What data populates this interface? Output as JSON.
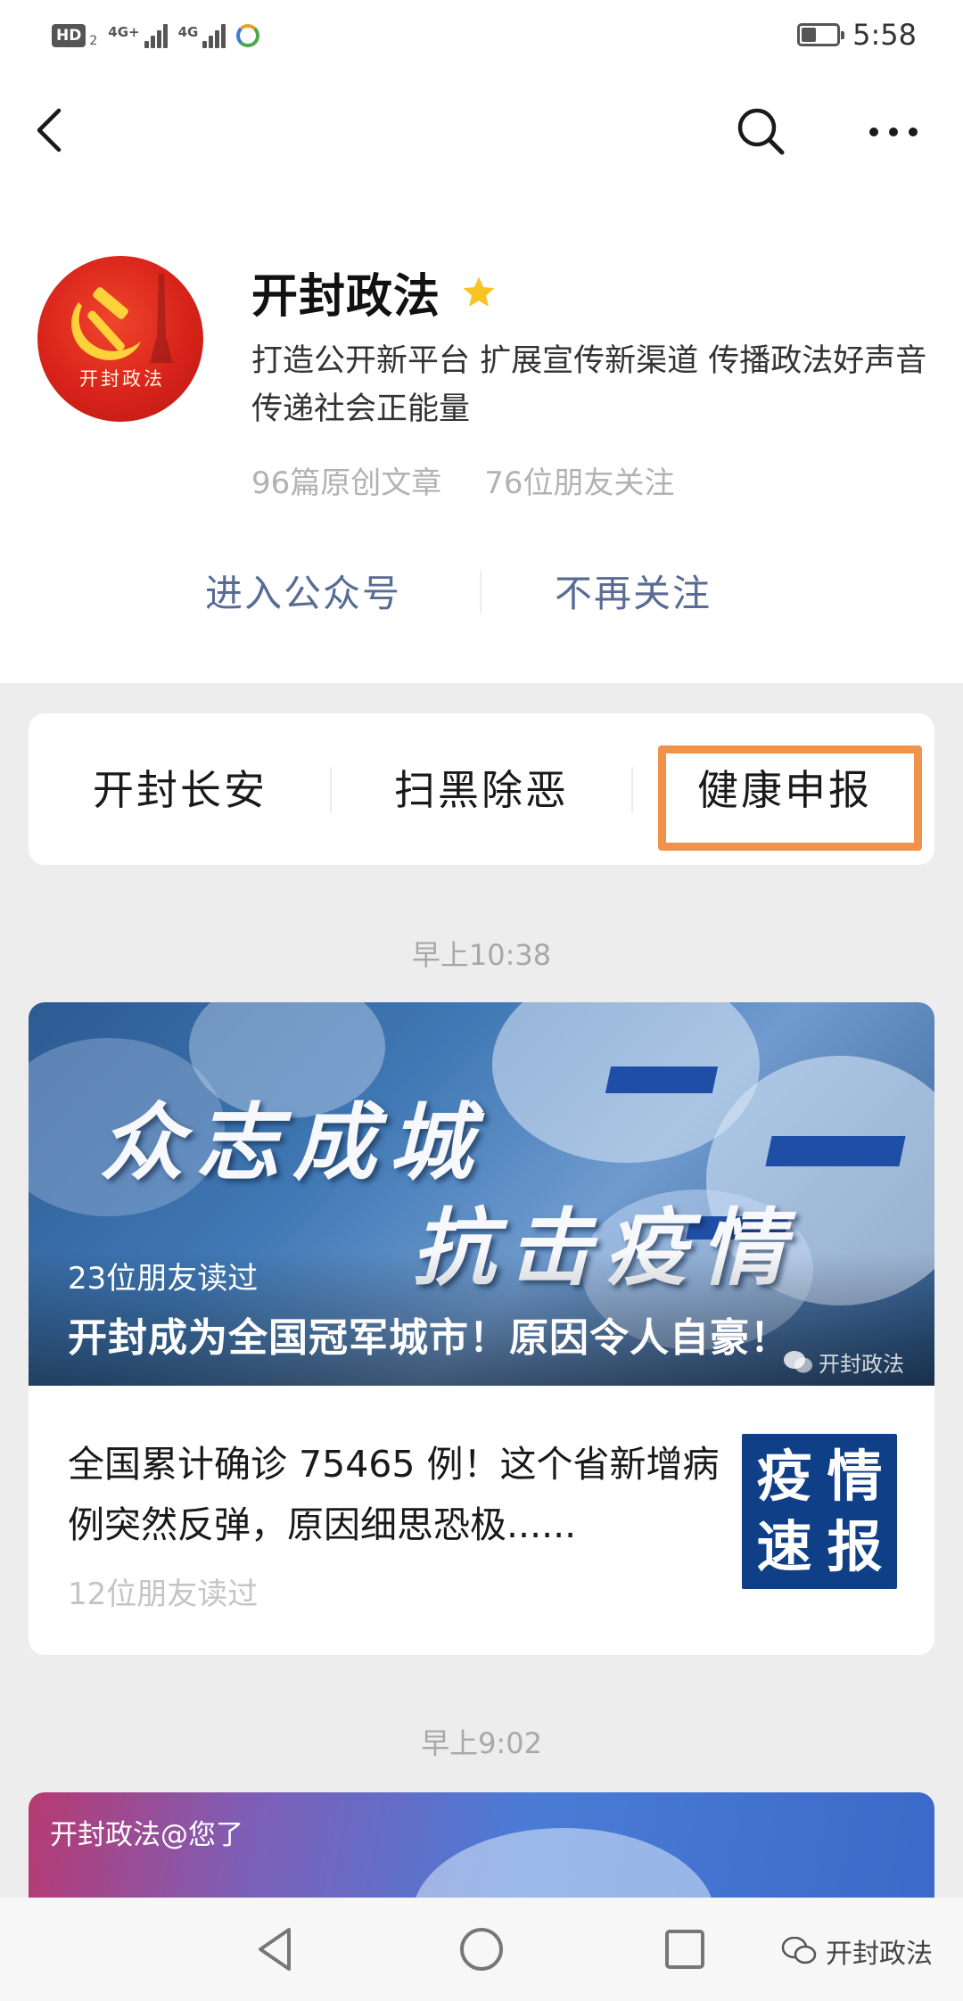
{
  "status_bar": {
    "hd_label": "HD",
    "hd_sub": "2",
    "net1_label": "4G+",
    "net2_label": "4G",
    "time": "5:58"
  },
  "profile": {
    "avatar_caption": "开封政法",
    "name": "开封政法",
    "description": "打造公开新平台 扩展宣传新渠道 传播政法好声音 传递社会正能量",
    "original_articles": "96篇原创文章",
    "friends_following": "76位朋友关注",
    "enter_label": "进入公众号",
    "unfollow_label": "不再关注"
  },
  "menu": {
    "items": [
      {
        "label": "开封长安"
      },
      {
        "label": "扫黑除恶"
      },
      {
        "label": "健康申报"
      }
    ]
  },
  "feed": {
    "groups": [
      {
        "timestamp": "早上10:38",
        "cover": {
          "headline_line1": "众志成城",
          "headline_line2": "抗击疫情",
          "reads": "23位朋友读过",
          "title": "开封成为全国冠军城市！原因令人自豪！",
          "watermark": "开封政法"
        },
        "sub_article": {
          "title": "全国累计确诊 75465 例！这个省新增病例突然反弹，原因细思恐极......",
          "reads": "12位朋友读过",
          "thumb_chars": [
            "疫",
            "情",
            "速",
            "报"
          ]
        }
      },
      {
        "timestamp": "早上9:02",
        "cover": {
          "mention": "开封政法@您了"
        }
      }
    ]
  },
  "bottom_watermark": "开封政法",
  "colors": {
    "link_blue": "#576b95",
    "highlight_orange": "#f0924a",
    "star_yellow": "#f7c325",
    "thumb_blue": "#0f3f86"
  }
}
